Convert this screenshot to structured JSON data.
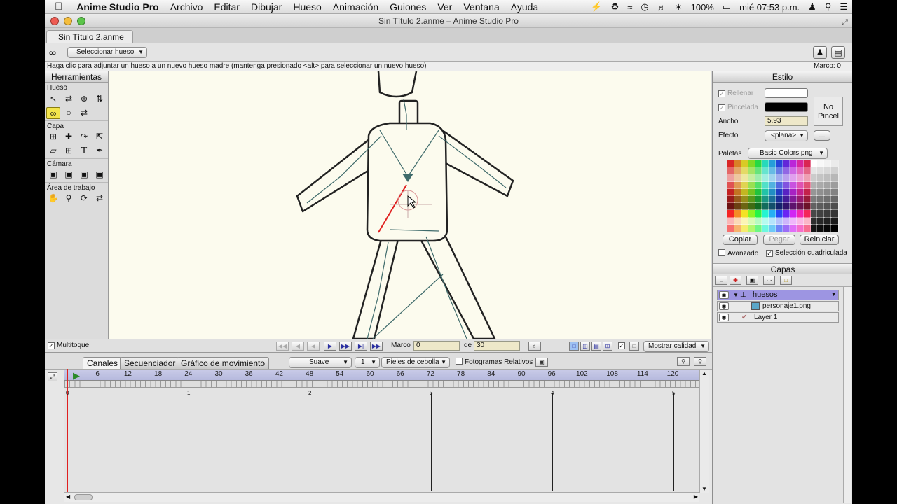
{
  "menubar": {
    "app_name": "Anime Studio Pro",
    "items": [
      "Archivo",
      "Editar",
      "Dibujar",
      "Hueso",
      "Animación",
      "Guiones",
      "Ver",
      "Ventana",
      "Ayuda"
    ],
    "battery": "100%",
    "clock": "mié 07:53 p.m."
  },
  "window": {
    "title": "Sin Título 2.anme – Anime Studio Pro",
    "doc_tab": "Sin Título 2.anme"
  },
  "toolbar": {
    "tool_popup": "Seleccionar hueso"
  },
  "status": {
    "hint": "Haga clic para adjuntar un hueso a un nuevo hueso madre (mantenga presionado <alt> para seleccionar un nuevo hueso)",
    "frame_label": "Marco: 0"
  },
  "tools_panel": {
    "title": "Herramientas",
    "sections": [
      "Hueso",
      "Capa",
      "Cámara",
      "Área de trabajo"
    ]
  },
  "playback": {
    "multitouch_label": "Multitoque",
    "frame_label": "Marco",
    "frame_value": "0",
    "of_label": "de",
    "total_frames": "30",
    "quality_popup": "Mostrar calidad"
  },
  "timeline": {
    "tabs": [
      "Canales",
      "Secuenciador",
      "Gráfico de movimiento"
    ],
    "interp_popup": "Suave",
    "step_popup": "1",
    "onion_popup": "Pieles de cebolla",
    "relative_label": "Fotogramas Relativos",
    "ruler_ticks": [
      "6",
      "12",
      "18",
      "24",
      "30",
      "36",
      "42",
      "48",
      "54",
      "60",
      "66",
      "72",
      "78",
      "84",
      "90",
      "96",
      "102",
      "108",
      "114",
      "120"
    ],
    "second_marks": [
      "0",
      "1",
      "2",
      "3",
      "4",
      "5"
    ]
  },
  "style_panel": {
    "title": "Estilo",
    "fill_label": "Rellenar",
    "stroke_label": "Pincelada",
    "width_label": "Ancho",
    "width_value": "5.93",
    "effect_label": "Efecto",
    "effect_value": "<plana>",
    "effect_extra": "...",
    "no_brush_line1": "No",
    "no_brush_line2": "Pincel",
    "palettes_label": "Paletas",
    "palette_value": "Basic Colors.png",
    "copy_label": "Copiar",
    "paste_label": "Pegar",
    "reset_label": "Reiniciar",
    "advanced_label": "Avanzado",
    "grid_select_label": "Selección cuadriculada"
  },
  "layers_panel": {
    "title": "Capas",
    "layers": [
      {
        "name": "huesos"
      },
      {
        "name": "personaje1.png"
      },
      {
        "name": "Layer 1"
      }
    ]
  },
  "colors": {
    "canvas_bg": "#fcfbee",
    "bone_color": "#3f6b6b",
    "selected_bone": "#e02020",
    "active_tool": "#f3e54b",
    "selected_layer": "#9d95e2"
  }
}
